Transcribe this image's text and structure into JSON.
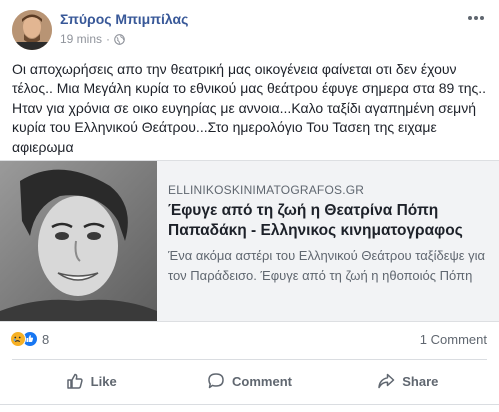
{
  "post": {
    "author": "Σπύρος Μπιμπίλας",
    "time": "19 mins",
    "separator": "·",
    "more_icon": "more-horizontal-icon",
    "privacy_icon": "globe-icon",
    "text": "Οι αποχωρήσεις απο την θεατρική μας οικογένεια φαίνεται οτι δεν έχουν τέλος.. Μια Μεγάλη κυρία το εθνικού μας θεάτρου έφυγε σημερα στα 89 της.. Ηταν για χρόνια σε οικο ευγηρίας με αννοια...Καλο ταξίδι αγαπημένη σεμνή κυρία του Ελληνικού Θεάτρου...Στο ημερολόγιο Του Τασεη της ειχαμε αφιερωμα"
  },
  "link_card": {
    "domain": "ELLINIKOSKINIMATOGRAFOS.GR",
    "title": "Έφυγε από τη ζωή η Θεατρίνα Πόπη Παπαδάκη - Ελληνικος κινηματογραφος",
    "description": "Ένα ακόμα αστέρι του Ελληνικού Θεάτρου ταξίδεψε για τον Παράδεισο. Έφυγε από τη ζωή η ηθοποιός Πόπη Παπαδάκη. Αν και ξεκίνησε ως..."
  },
  "stats": {
    "reaction_count": "8",
    "reactions": [
      "sad-reaction-icon",
      "like-reaction-icon"
    ],
    "comments": "1 Comment"
  },
  "actions": {
    "like": "Like",
    "comment": "Comment",
    "share": "Share"
  },
  "colors": {
    "author_link": "#385898",
    "secondary_text": "#606770",
    "card_bg": "#f2f3f5",
    "like_blue": "#1877f2",
    "sad_yellow": "#f7b125"
  }
}
